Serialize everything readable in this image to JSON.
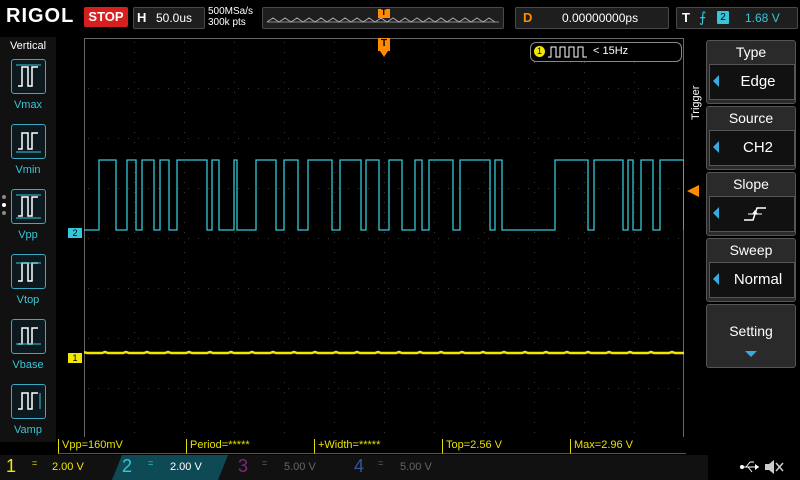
{
  "header": {
    "brand": "RIGOL",
    "run_state": "STOP",
    "horizontal_key": "H",
    "timebase": "50.0us",
    "sample_rate": "500MSa/s",
    "memory_depth": "300k pts",
    "trigger_marker": "T",
    "delay_key": "D",
    "delay": "0.00000000ps",
    "trigger_key": "T",
    "trigger_channel": "2",
    "trigger_level": "1.68 V"
  },
  "left_panel": {
    "title": "Vertical",
    "items": [
      {
        "label": "Vmax",
        "icon": "vmax-icon"
      },
      {
        "label": "Vmin",
        "icon": "vmin-icon"
      },
      {
        "label": "Vpp",
        "icon": "vpp-icon"
      },
      {
        "label": "Vtop",
        "icon": "vtop-icon"
      },
      {
        "label": "Vbase",
        "icon": "vbase-icon"
      },
      {
        "label": "Vamp",
        "icon": "vamp-icon"
      }
    ]
  },
  "right_panel": {
    "title": "Trigger",
    "menu": [
      {
        "title": "Type",
        "value": "Edge"
      },
      {
        "title": "Source",
        "value": "CH2"
      },
      {
        "title": "Slope",
        "value": ""
      },
      {
        "title": "Sweep",
        "value": "Normal"
      },
      {
        "title": "Setting",
        "value": ""
      }
    ]
  },
  "plot": {
    "frequency_badge_channel": "1",
    "frequency_badge_text": "< 15Hz",
    "ch1_marker": "1",
    "ch2_marker": "2",
    "trigger_top_marker": "T",
    "trigger_level_marker": "T",
    "colors": {
      "ch1": "#f0e800",
      "ch2": "#35c8d8",
      "trigger": "#ff8c00",
      "grid": "#3a3a3a"
    }
  },
  "measurements": [
    {
      "text": "Vpp=160mV"
    },
    {
      "text": "Period=*****"
    },
    {
      "text": "+Width=*****"
    },
    {
      "text": "Top=2.56 V"
    },
    {
      "text": "Max=2.96 V"
    }
  ],
  "channels": [
    {
      "number": "1",
      "coupling": "=",
      "scale": "2.00 V",
      "color": "#f0e800",
      "active": true
    },
    {
      "number": "2",
      "coupling": "=",
      "scale": "2.00 V",
      "color": "#35c8d8",
      "active": true
    },
    {
      "number": "3",
      "coupling": "=",
      "scale": "5.00 V",
      "color": "#a0339a",
      "active": false
    },
    {
      "number": "4",
      "coupling": "=",
      "scale": "5.00 V",
      "color": "#3355aa",
      "active": false
    }
  ],
  "status_icons": [
    "usb-icon",
    "sound-mute-icon"
  ]
}
